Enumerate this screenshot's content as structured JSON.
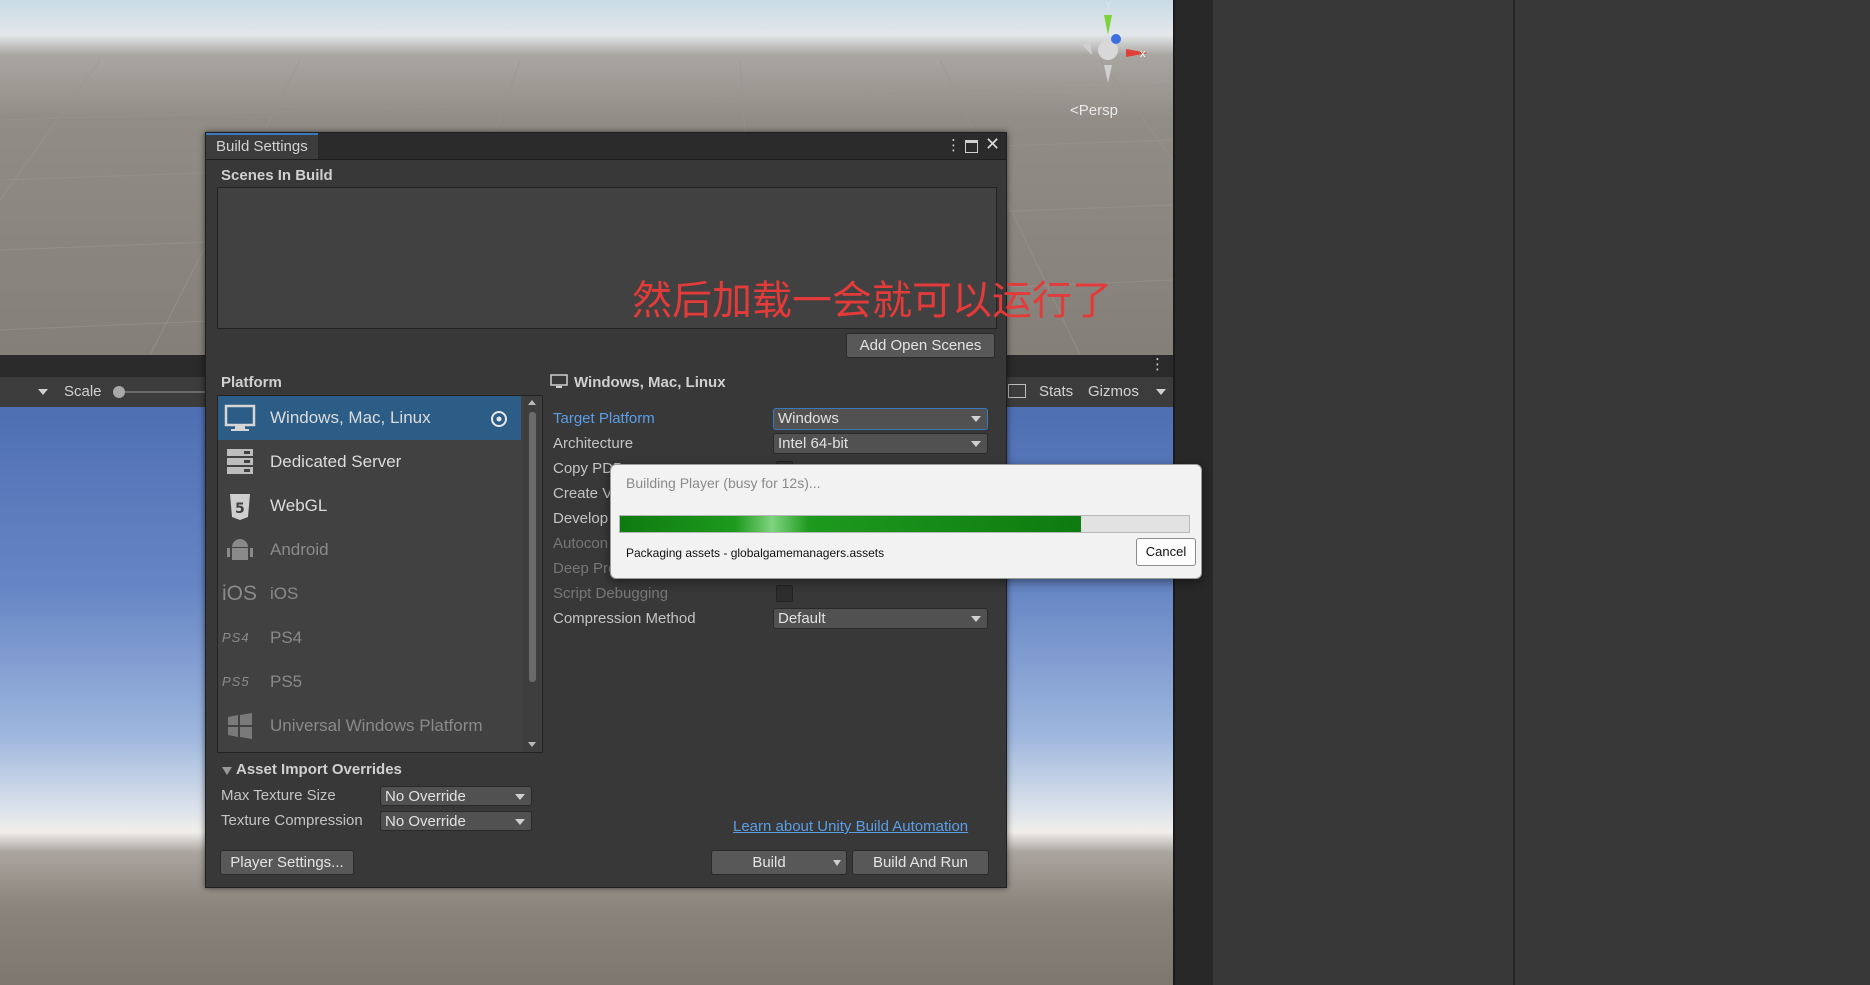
{
  "scene": {
    "persp_label": "<Persp",
    "axis_y": "y",
    "axis_x": "x"
  },
  "game_toolbar": {
    "scale_label": "Scale",
    "stats_label": "Stats",
    "gizmos_label": "Gizmos"
  },
  "build_window": {
    "title": "Build Settings",
    "scenes_header": "Scenes In Build",
    "add_open_scenes": "Add Open Scenes",
    "platform_header": "Platform",
    "platforms": [
      {
        "label": "Windows, Mac, Linux",
        "icon": "monitor-icon",
        "selected": true,
        "enabled": true
      },
      {
        "label": "Dedicated Server",
        "icon": "server-icon",
        "selected": false,
        "enabled": true
      },
      {
        "label": "WebGL",
        "icon": "html5-icon",
        "selected": false,
        "enabled": true
      },
      {
        "label": "Android",
        "icon": "android-icon",
        "selected": false,
        "enabled": false
      },
      {
        "label": "iOS",
        "icon": "ios-icon",
        "selected": false,
        "enabled": false
      },
      {
        "label": "PS4",
        "icon": "ps4-icon",
        "selected": false,
        "enabled": false
      },
      {
        "label": "PS5",
        "icon": "ps5-icon",
        "selected": false,
        "enabled": false
      },
      {
        "label": "Universal Windows Platform",
        "icon": "windows-icon",
        "selected": false,
        "enabled": false
      }
    ],
    "asset_overrides": {
      "header": "Asset Import Overrides",
      "max_texture_label": "Max Texture Size",
      "max_texture_value": "No Override",
      "texture_compression_label": "Texture Compression",
      "texture_compression_value": "No Override"
    },
    "player_settings": "Player Settings...",
    "detail": {
      "header": "Windows, Mac, Linux",
      "target_platform_label": "Target Platform",
      "target_platform_value": "Windows",
      "architecture_label": "Architecture",
      "architecture_value": "Intel 64-bit",
      "copy_pdb_label": "Copy PDB",
      "create_vs_label": "Create V",
      "development_label": "Develop",
      "autoconnect_label": "Autocon",
      "deep_profiling_label": "Deep Pro",
      "script_debugging_label": "Script Debugging",
      "compression_label": "Compression Method",
      "compression_value": "Default"
    },
    "learn_link": "Learn about Unity Build Automation",
    "build": "Build",
    "build_and_run": "Build And Run"
  },
  "progress": {
    "title": "Building Player (busy for 12s)...",
    "value": 0.81,
    "status": "Packaging assets - globalgamemanagers.assets",
    "cancel": "Cancel"
  },
  "annotation": "然后加载一会就可以运行了",
  "colors": {
    "accent": "#2c5d87",
    "link": "#5b9ee6",
    "progress": "#1d9a1d",
    "annotation": "#e33a3a"
  }
}
